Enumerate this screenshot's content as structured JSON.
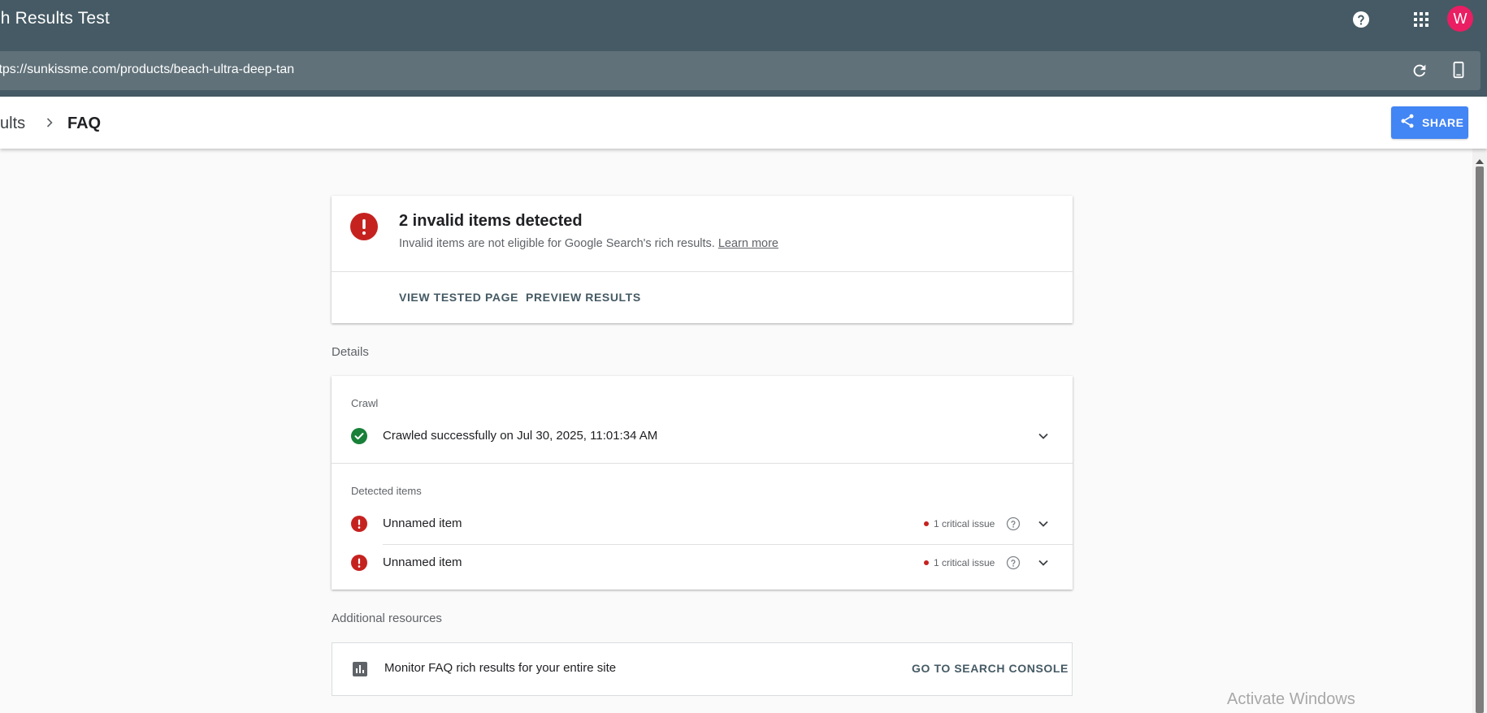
{
  "app": {
    "title": "ch Results Test"
  },
  "header": {
    "help_icon": "help-icon",
    "apps_icon": "apps-grid-icon",
    "avatar_initial": "W",
    "avatar_color": "#e91e63"
  },
  "url_bar": {
    "url": "ttps://sunkissme.com/products/beach-ultra-deep-tan",
    "refresh_icon": "refresh-icon",
    "device_icon": "smartphone-icon"
  },
  "breadcrumb": {
    "parent": "sults",
    "current": "FAQ"
  },
  "share": {
    "label": "SHARE",
    "icon": "share-icon",
    "color": "#4285f4"
  },
  "summary": {
    "title": "2 invalid items detected",
    "subtitle": "Invalid items are not eligible for Google Search's rich results.",
    "learn_more": "Learn more",
    "actions": [
      "VIEW TESTED PAGE",
      "PREVIEW RESULTS"
    ],
    "error_color": "#c5221f"
  },
  "details": {
    "heading": "Details",
    "crawl": {
      "label": "Crawl",
      "status": "Crawled successfully on Jul 30, 2025, 11:01:34 AM",
      "success_color": "#188038"
    },
    "detected": {
      "label": "Detected items",
      "items": [
        {
          "name": "Unnamed item",
          "issue": "1 critical issue"
        },
        {
          "name": "Unnamed item",
          "issue": "1 critical issue"
        }
      ]
    }
  },
  "resources": {
    "heading": "Additional resources",
    "text": "Monitor FAQ rich results for your entire site",
    "link": "GO TO SEARCH CONSOLE"
  },
  "watermark": "Activate Windows"
}
